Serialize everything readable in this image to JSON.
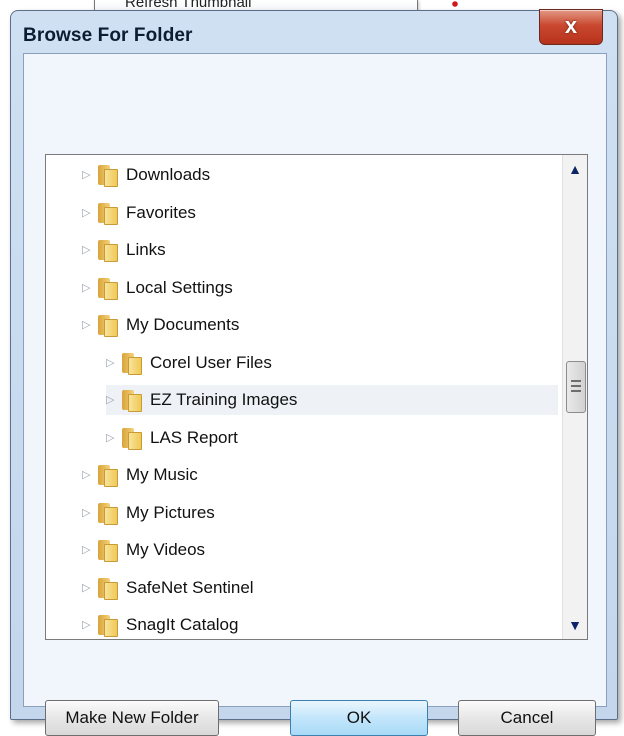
{
  "tooltip": {
    "text": "Refresh Thumbnail"
  },
  "dialog": {
    "title": "Browse For Folder",
    "close_symbol": "x",
    "accent_color": "#c9482f"
  },
  "tree": {
    "items": [
      {
        "label": "Downloads",
        "level": 0,
        "selected": false
      },
      {
        "label": "Favorites",
        "level": 0,
        "selected": false
      },
      {
        "label": "Links",
        "level": 0,
        "selected": false
      },
      {
        "label": "Local Settings",
        "level": 0,
        "selected": false
      },
      {
        "label": "My Documents",
        "level": 0,
        "selected": false
      },
      {
        "label": "Corel User Files",
        "level": 1,
        "selected": false
      },
      {
        "label": "EZ Training Images",
        "level": 1,
        "selected": true
      },
      {
        "label": "LAS Report",
        "level": 1,
        "selected": false
      },
      {
        "label": "My Music",
        "level": 0,
        "selected": false
      },
      {
        "label": "My Pictures",
        "level": 0,
        "selected": false
      },
      {
        "label": "My Videos",
        "level": 0,
        "selected": false
      },
      {
        "label": "SafeNet Sentinel",
        "level": 0,
        "selected": false
      },
      {
        "label": "SnagIt Catalog",
        "level": 0,
        "selected": false
      }
    ],
    "icons": {
      "folder": "folder-icon",
      "expander": "expand-arrow-icon"
    }
  },
  "buttons": {
    "make_new_folder": "Make New Folder",
    "ok": "OK",
    "cancel": "Cancel"
  }
}
